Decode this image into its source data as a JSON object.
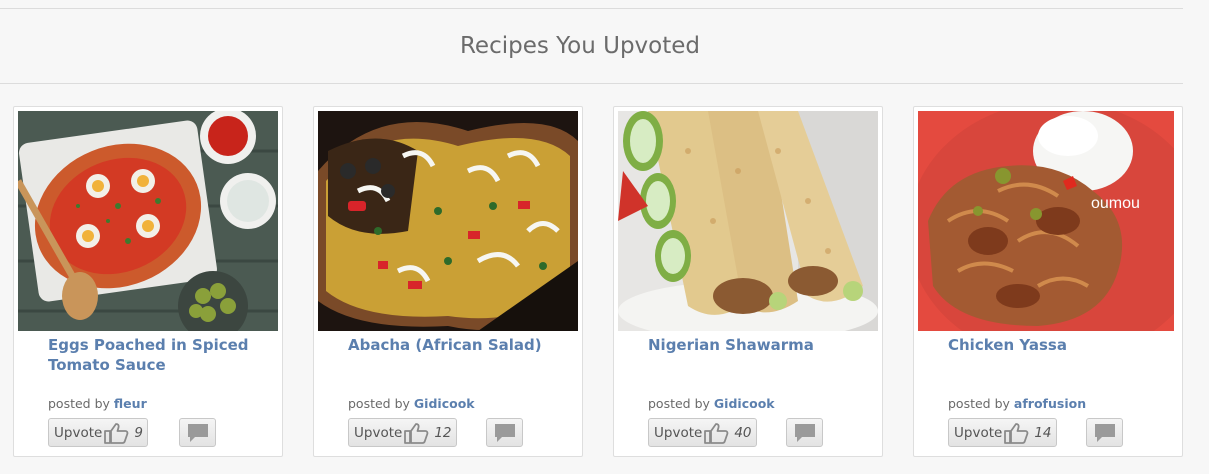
{
  "section": {
    "title": "Recipes You Upvoted"
  },
  "recipes": [
    {
      "title": "Eggs Poached in Spiced Tomato Sauce",
      "posted_prefix": "posted by",
      "author": "fleur",
      "upvote_label": "Upvote",
      "upvotes": "9",
      "image": "shakshuka-photo"
    },
    {
      "title": "Abacha (African Salad)",
      "posted_prefix": "posted by",
      "author": "Gidicook",
      "upvote_label": "Upvote",
      "upvotes": "12",
      "image": "abacha-salad-photo"
    },
    {
      "title": "Nigerian Shawarma",
      "posted_prefix": "posted by",
      "author": "Gidicook",
      "upvote_label": "Upvote",
      "upvotes": "40",
      "image": "shawarma-wraps-photo"
    },
    {
      "title": "Chicken Yassa",
      "posted_prefix": "posted by",
      "author": "afrofusion",
      "upvote_label": "Upvote",
      "upvotes": "14",
      "image": "chicken-yassa-photo",
      "watermark": "oumou"
    }
  ],
  "icons": {
    "upvote": "thumbs-up-icon",
    "comment": "speech-bubble-icon"
  },
  "colors": {
    "link": "#5b7fae",
    "title": "#6b6b6b",
    "icon": "#9a9a9a"
  }
}
